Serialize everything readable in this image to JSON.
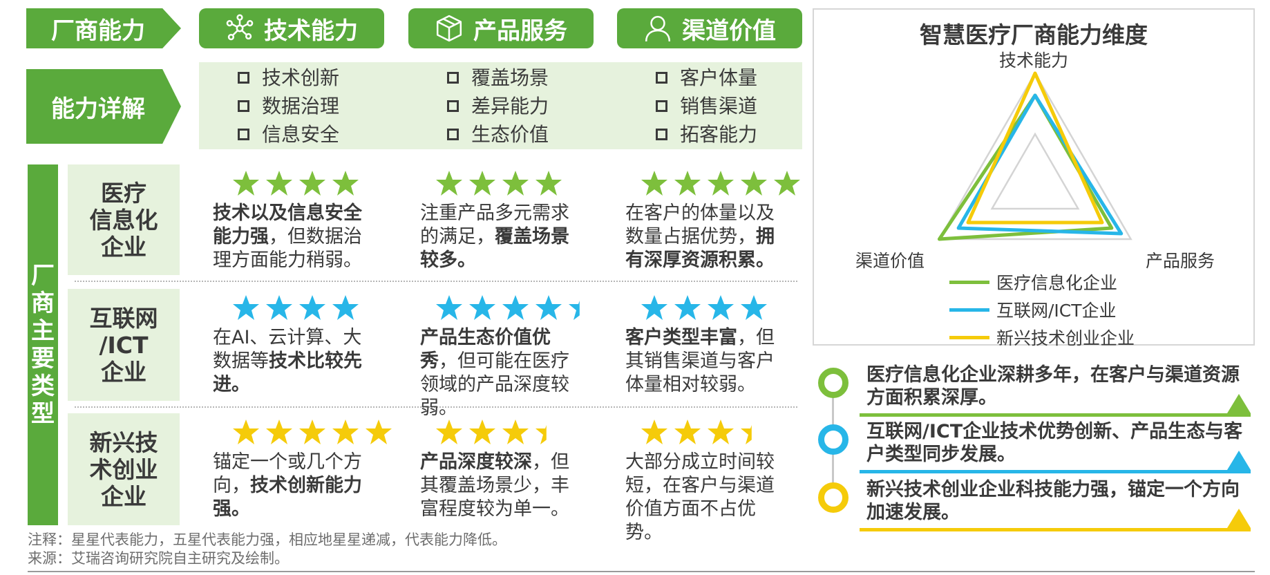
{
  "row_headers": {
    "ability": "厂商能力",
    "detail": "能力详解"
  },
  "columns": [
    {
      "title": "技术能力",
      "icon": "molecule-icon",
      "items": [
        "技术创新",
        "数据治理",
        "信息安全"
      ]
    },
    {
      "title": "产品服务",
      "icon": "cube-icon",
      "items": [
        "覆盖场景",
        "差异能力",
        "生态价值"
      ]
    },
    {
      "title": "渠道价值",
      "icon": "person-icon",
      "items": [
        "客户体量",
        "销售渠道",
        "拓客能力"
      ]
    }
  ],
  "vertical_label": "厂商主要类型",
  "types": [
    {
      "name": [
        "医疗",
        "信息化",
        "企业"
      ],
      "star_color": "#7dbf3c",
      "cells": [
        {
          "stars": 4,
          "parts": [
            [
              "技术以及信息安全能力强",
              true
            ],
            [
              "，但数据治理方面能力稍弱。",
              false
            ]
          ]
        },
        {
          "stars": 4,
          "parts": [
            [
              "注重产品多元需求的满足，",
              false
            ],
            [
              "覆盖场景较多。",
              true
            ]
          ]
        },
        {
          "stars": 5,
          "parts": [
            [
              "在客户的体量以及数量占据优势，",
              false
            ],
            [
              "拥有深厚资源积累。",
              true
            ]
          ]
        }
      ]
    },
    {
      "name": [
        "互联网",
        "/ICT",
        "企业"
      ],
      "star_color": "#27b6e8",
      "cells": [
        {
          "stars": 4,
          "parts": [
            [
              "在AI、云计算、大数据等",
              false
            ],
            [
              "技术比较先进。",
              true
            ]
          ]
        },
        {
          "stars": 4.5,
          "parts": [
            [
              "产品生态价值优秀",
              true
            ],
            [
              "，但可能在医疗领域的产品深度较弱。",
              false
            ]
          ]
        },
        {
          "stars": 4,
          "parts": [
            [
              "客户类型丰富",
              true
            ],
            [
              "，但其销售渠道与客户体量相对较弱。",
              false
            ]
          ]
        }
      ]
    },
    {
      "name": [
        "新兴技",
        "术创业",
        "企业"
      ],
      "star_color": "#f5cb0a",
      "cells": [
        {
          "stars": 5,
          "parts": [
            [
              "锚定一个或几个方向，",
              false
            ],
            [
              "技术创新能力强。",
              true
            ]
          ]
        },
        {
          "stars": 3.5,
          "parts": [
            [
              "产品深度较深",
              true
            ],
            [
              "，但其覆盖场景少，丰富程度较为单一。",
              false
            ]
          ]
        },
        {
          "stars": 3.5,
          "parts": [
            [
              "大部分成立时间较短，在客户与渠道价值方面不占优势。",
              false
            ]
          ]
        }
      ]
    }
  ],
  "chart_data": {
    "type": "radar",
    "title": "智慧医疗厂商能力维度",
    "axes": [
      "技术能力",
      "产品服务",
      "渠道价值"
    ],
    "max": 5,
    "series": [
      {
        "name": "医疗信息化企业",
        "color": "#7dbf3c",
        "values": [
          4,
          4,
          5
        ]
      },
      {
        "name": "互联网/ICT企业",
        "color": "#27b6e8",
        "values": [
          4,
          4.5,
          4
        ]
      },
      {
        "name": "新兴技术创业企业",
        "color": "#f5cb0a",
        "values": [
          5,
          3.5,
          3.5
        ]
      }
    ]
  },
  "summaries": [
    {
      "color": "#7dbf3c",
      "text": "医疗信息化企业深耕多年，在客户与渠道资源方面积累深厚。"
    },
    {
      "color": "#27b6e8",
      "text": "互联网/ICT企业技术优势创新、产品生态与客户类型同步发展。"
    },
    {
      "color": "#f5cb0a",
      "text": "新兴技术创业企业科技能力强，锚定一个方向加速发展。"
    }
  ],
  "footnotes": {
    "note": "注释：星星代表能力，五星代表能力强，相应地星星递减，代表能力降低。",
    "source": "来源：艾瑞咨询研究院自主研究及绘制。"
  }
}
